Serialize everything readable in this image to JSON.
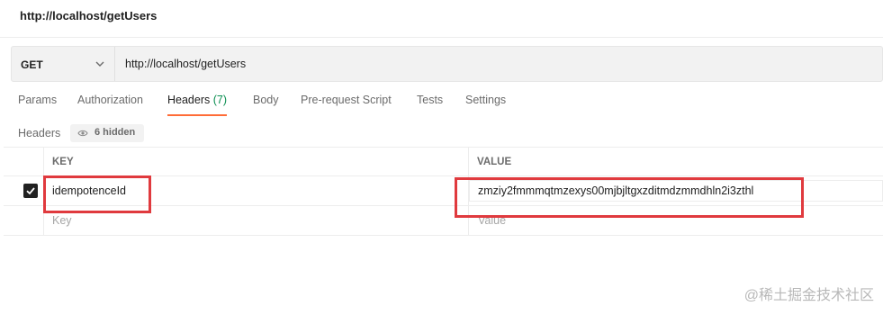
{
  "request": {
    "title": "http://localhost/getUsers",
    "method": "GET",
    "url": "http://localhost/getUsers"
  },
  "tabs": [
    {
      "label": "Params"
    },
    {
      "label": "Authorization"
    },
    {
      "label": "Headers",
      "count": "(7)",
      "active": true
    },
    {
      "label": "Body"
    },
    {
      "label": "Pre-request Script"
    },
    {
      "label": "Tests"
    },
    {
      "label": "Settings"
    }
  ],
  "headers_section": {
    "label": "Headers",
    "hidden_text": "6 hidden"
  },
  "table": {
    "columns": [
      "KEY",
      "VALUE"
    ],
    "rows": [
      {
        "checked": true,
        "key": "idempotenceId",
        "value": "zmziy2fmmmqtmzexys00mjbjltgxzditmdzmmdhln2i3zthl"
      }
    ],
    "placeholder": {
      "key": "Key",
      "value": "Value"
    }
  },
  "watermark": "@稀土掘金技术社区",
  "colors": {
    "accent": "#ff6c37",
    "count": "#0a8e50",
    "highlight": "#e03a3e"
  },
  "icons": [
    "chevron-down-icon",
    "eye-icon",
    "checkmark-icon"
  ]
}
